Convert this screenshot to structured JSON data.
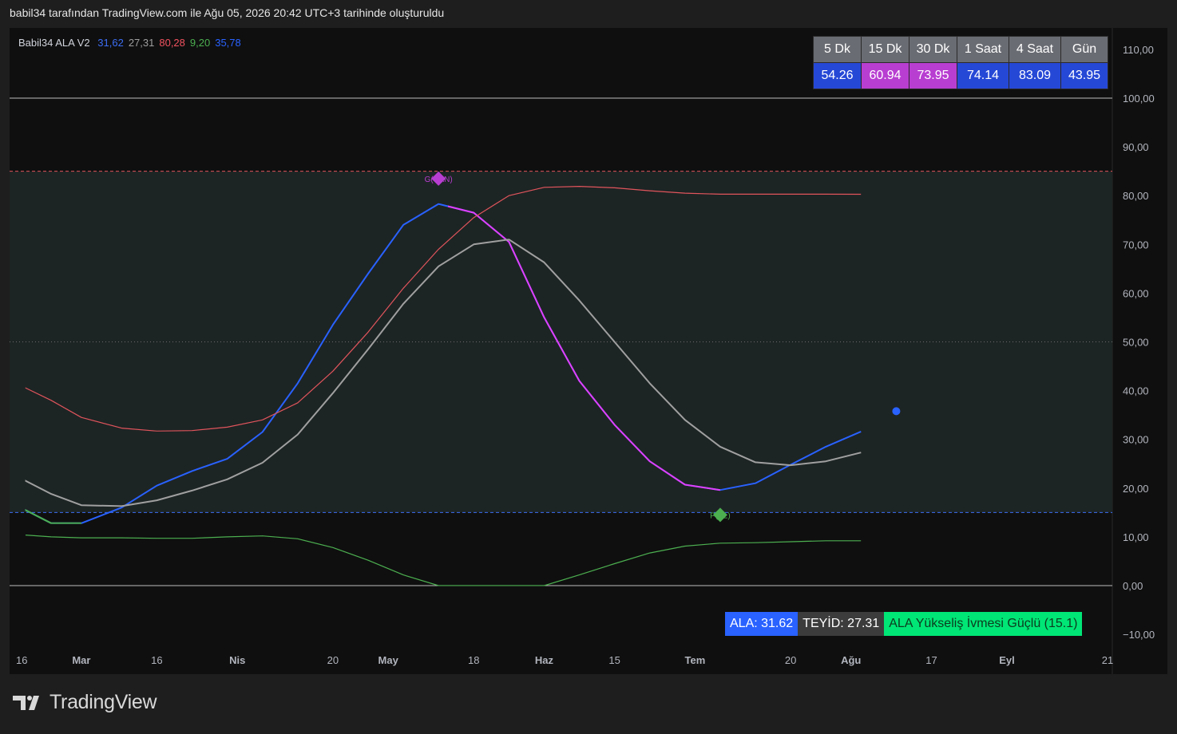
{
  "header": {
    "text": "babil34 tarafından TradingView.com ile Ağu 05, 2026 20:42 UTC+3 tarihinde oluşturuldu"
  },
  "legend": {
    "name": "Babil34 ALA V2",
    "values": [
      {
        "text": "31,62",
        "color": "#3d6ef5"
      },
      {
        "text": "27,31",
        "color": "#9e9e9e"
      },
      {
        "text": "80,28",
        "color": "#f0525f"
      },
      {
        "text": "9,20",
        "color": "#4caf50"
      },
      {
        "text": "35,78",
        "color": "#2962ff"
      }
    ]
  },
  "timeframe_table": {
    "headers": [
      "5 Dk",
      "15 Dk",
      "30 Dk",
      "1 Saat",
      "4 Saat",
      "Gün"
    ],
    "values": [
      "54.26",
      "60.94",
      "73.95",
      "74.14",
      "83.09",
      "43.95"
    ],
    "value_colors": [
      "#2648d6",
      "#b83ed1",
      "#b83ed1",
      "#2648d6",
      "#2648d6",
      "#2648d6"
    ]
  },
  "status_bar": {
    "ala": {
      "text": "ALA: 31.62",
      "bg": "#2962ff",
      "color": "#ffffff"
    },
    "teyid": {
      "text": "TEYİD: 27.31",
      "bg": "#3c3c3c",
      "color": "#ffffff"
    },
    "signal": {
      "text": "ALA Yükseliş İvmesi Güçlü (15.1)",
      "bg": "#00e676",
      "color": "#0c3b1e"
    }
  },
  "footer": {
    "brand": "TradingView"
  },
  "chart_data": {
    "type": "line",
    "ylim": [
      -13,
      115
    ],
    "y_ticks": [
      {
        "value": 110,
        "label": "110,00"
      },
      {
        "value": 100,
        "label": "100,00"
      },
      {
        "value": 90,
        "label": "90,00"
      },
      {
        "value": 80,
        "label": "80,00"
      },
      {
        "value": 70,
        "label": "70,00"
      },
      {
        "value": 60,
        "label": "60,00"
      },
      {
        "value": 50,
        "label": "50,00"
      },
      {
        "value": 40,
        "label": "40,00"
      },
      {
        "value": 30,
        "label": "30,00"
      },
      {
        "value": 20,
        "label": "20,00"
      },
      {
        "value": 10,
        "label": "10,00"
      },
      {
        "value": 0,
        "label": "0,00"
      },
      {
        "value": -10,
        "label": "−10,00"
      }
    ],
    "x_ticks": [
      {
        "date": "2026-02-16",
        "label": "16"
      },
      {
        "date": "2026-03-01",
        "label": "Mar"
      },
      {
        "date": "2026-03-16",
        "label": "16"
      },
      {
        "date": "2026-04-01",
        "label": "Nis"
      },
      {
        "date": "2026-04-20",
        "label": "20"
      },
      {
        "date": "2026-05-01",
        "label": "May"
      },
      {
        "date": "2026-05-18",
        "label": "18"
      },
      {
        "date": "2026-06-01",
        "label": "Haz"
      },
      {
        "date": "2026-06-15",
        "label": "15"
      },
      {
        "date": "2026-07-01",
        "label": "Tem"
      },
      {
        "date": "2026-07-20",
        "label": "20"
      },
      {
        "date": "2026-08-01",
        "label": "Ağu"
      },
      {
        "date": "2026-08-17",
        "label": "17"
      },
      {
        "date": "2026-09-01",
        "label": "Eyl"
      },
      {
        "date": "2026-09-21",
        "label": "21"
      }
    ],
    "xlim": [
      "2026-02-16",
      "2026-09-21"
    ],
    "zone": {
      "upper": 85,
      "lower": 15,
      "fill": "#1d2424"
    },
    "hlines": [
      {
        "value": 100,
        "color": "#bdbdbd",
        "style": "solid"
      },
      {
        "value": 85,
        "color": "#e0555c",
        "style": "dashed"
      },
      {
        "value": 50,
        "color": "#6b6b6b",
        "style": "dotted"
      },
      {
        "value": 15,
        "color": "#3d6ef5",
        "style": "dashed"
      },
      {
        "value": 0,
        "color": "#bdbdbd",
        "style": "solid"
      }
    ],
    "x": [
      "2026-02-16",
      "2026-02-23",
      "2026-03-01",
      "2026-03-09",
      "2026-03-16",
      "2026-03-23",
      "2026-03-30",
      "2026-04-06",
      "2026-04-13",
      "2026-04-20",
      "2026-04-27",
      "2026-05-04",
      "2026-05-11",
      "2026-05-18",
      "2026-05-25",
      "2026-06-01",
      "2026-06-08",
      "2026-06-15",
      "2026-06-22",
      "2026-06-29",
      "2026-07-06",
      "2026-07-13",
      "2026-07-20",
      "2026-07-27",
      "2026-08-03"
    ],
    "series": [
      {
        "key": "ala",
        "color": "#2962ff",
        "width": 2,
        "values": [
          16.5,
          12.8,
          12.8,
          16,
          20.5,
          23.5,
          26,
          31.5,
          41.5,
          53.5,
          64,
          74,
          78.3,
          76.5,
          70.5,
          55,
          42,
          33,
          25.5,
          20.7,
          19.6,
          21,
          24.8,
          28.5,
          31.6
        ]
      },
      {
        "key": "ala_colored_segment",
        "color": "#e040fb",
        "width": 2,
        "values": [
          null,
          null,
          null,
          null,
          null,
          null,
          null,
          null,
          null,
          null,
          null,
          null,
          78.3,
          76.5,
          70.5,
          55,
          42,
          33,
          25.5,
          20.7,
          19.6,
          null,
          null,
          null,
          null
        ]
      },
      {
        "key": "ala_low_segment",
        "color": "#4caf50",
        "width": 2,
        "values": [
          16.5,
          12.8,
          12.8,
          null,
          null,
          null,
          null,
          null,
          null,
          null,
          null,
          null,
          null,
          null,
          null,
          null,
          null,
          null,
          null,
          null,
          null,
          null,
          null,
          null,
          null
        ]
      },
      {
        "key": "teyid",
        "color": "#a0a0a0",
        "width": 2,
        "values": [
          22.5,
          18.8,
          16.5,
          16.3,
          17.5,
          19.5,
          21.8,
          25.2,
          31,
          39.5,
          48.5,
          57.8,
          65.5,
          70,
          71,
          66.3,
          58.5,
          50,
          41.5,
          34,
          28.5,
          25.3,
          24.7,
          25.5,
          27.3
        ]
      },
      {
        "key": "red_line",
        "color": "#e0555c",
        "width": 1.2,
        "values": [
          41.5,
          38,
          34.5,
          32.3,
          31.7,
          31.8,
          32.5,
          34,
          37.5,
          44,
          52,
          61,
          69,
          75.5,
          80,
          81.7,
          81.9,
          81.6,
          81,
          80.5,
          80.3,
          80.3,
          80.3,
          80.3,
          80.28
        ]
      },
      {
        "key": "green_line",
        "color": "#4caf50",
        "width": 1.2,
        "values": [
          10.5,
          10,
          9.8,
          9.8,
          9.7,
          9.7,
          10,
          10.2,
          9.6,
          7.8,
          5.2,
          2.2,
          0,
          0,
          0,
          0,
          2.2,
          4.5,
          6.7,
          8.1,
          8.7,
          8.8,
          9,
          9.2,
          9.2
        ]
      }
    ],
    "markers": [
      {
        "date": "2026-05-11",
        "value": 83.5,
        "shape": "diamond",
        "color": "#b83ed1",
        "label": "G(SAN)"
      },
      {
        "date": "2026-07-06",
        "value": 14.5,
        "shape": "diamond",
        "color": "#4caf50",
        "label": "P(AL)"
      },
      {
        "date": "2026-08-10",
        "value": 35.78,
        "shape": "dot",
        "color": "#2962ff",
        "label": ""
      }
    ]
  }
}
